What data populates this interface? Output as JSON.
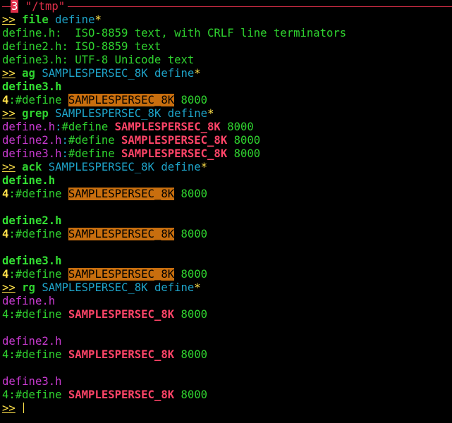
{
  "window": {
    "number": "3",
    "title": " \"/tmp\""
  },
  "prompt": ">>",
  "colors": {
    "background": "#000000",
    "text_green": "#2fd32f",
    "prompt_yellow": "#ffe14a",
    "arg_cyan": "#1ea3c8",
    "file_magenta": "#c83ad0",
    "match_red": "#ff4468",
    "match_highlight_bg": "#c86e0e",
    "status_red": "#e0304a"
  },
  "file_cmd": {
    "command": "file",
    "args": "define",
    "star": "*",
    "output": [
      "define.h:  ISO-8859 text, with CRLF line terminators",
      "define2.h: ISO-8859 text",
      "define3.h: UTF-8 Unicode text"
    ]
  },
  "ag_cmd": {
    "command": "ag",
    "args": "SAMPLESPERSEC_8K define",
    "star": "*",
    "results": [
      {
        "file": "define3.h",
        "lnum": "4",
        "pre": ":#define ",
        "match": "SAMPLESPERSEC_8K",
        "post": " 8000"
      }
    ]
  },
  "grep_cmd": {
    "command": "grep",
    "args": "SAMPLESPERSEC_8K define",
    "star": "*",
    "results": [
      {
        "file": "define.h",
        "sep": ":",
        "pre": "#define ",
        "match": "SAMPLESPERSEC_8K",
        "post": " 8000"
      },
      {
        "file": "define2.h",
        "sep": ":",
        "pre": "#define ",
        "match": "SAMPLESPERSEC_8K",
        "post": " 8000"
      },
      {
        "file": "define3.h",
        "sep": ":",
        "pre": "#define ",
        "match": "SAMPLESPERSEC_8K",
        "post": " 8000"
      }
    ]
  },
  "ack_cmd": {
    "command": "ack",
    "args": "SAMPLESPERSEC_8K define",
    "star": "*",
    "results": [
      {
        "file": "define.h",
        "lnum": "4",
        "pre": ":#define ",
        "match": "SAMPLESPERSEC_8K",
        "post": " 8000"
      },
      {
        "file": "define2.h",
        "lnum": "4",
        "pre": ":#define ",
        "match": "SAMPLESPERSEC_8K",
        "post": " 8000"
      },
      {
        "file": "define3.h",
        "lnum": "4",
        "pre": ":#define ",
        "match": "SAMPLESPERSEC_8K",
        "post": " 8000"
      }
    ]
  },
  "rg_cmd": {
    "command": "rg",
    "args": "SAMPLESPERSEC_8K define",
    "star": "*",
    "results": [
      {
        "file": "define.h",
        "lnum": "4",
        "pre": ":#define ",
        "match": "SAMPLESPERSEC_8K",
        "post": " 8000"
      },
      {
        "file": "define2.h",
        "lnum": "4",
        "pre": ":#define ",
        "match": "SAMPLESPERSEC_8K",
        "post": " 8000"
      },
      {
        "file": "define3.h",
        "lnum": "4",
        "pre": ":#define ",
        "match": "SAMPLESPERSEC_8K",
        "post": " 8000"
      }
    ]
  }
}
